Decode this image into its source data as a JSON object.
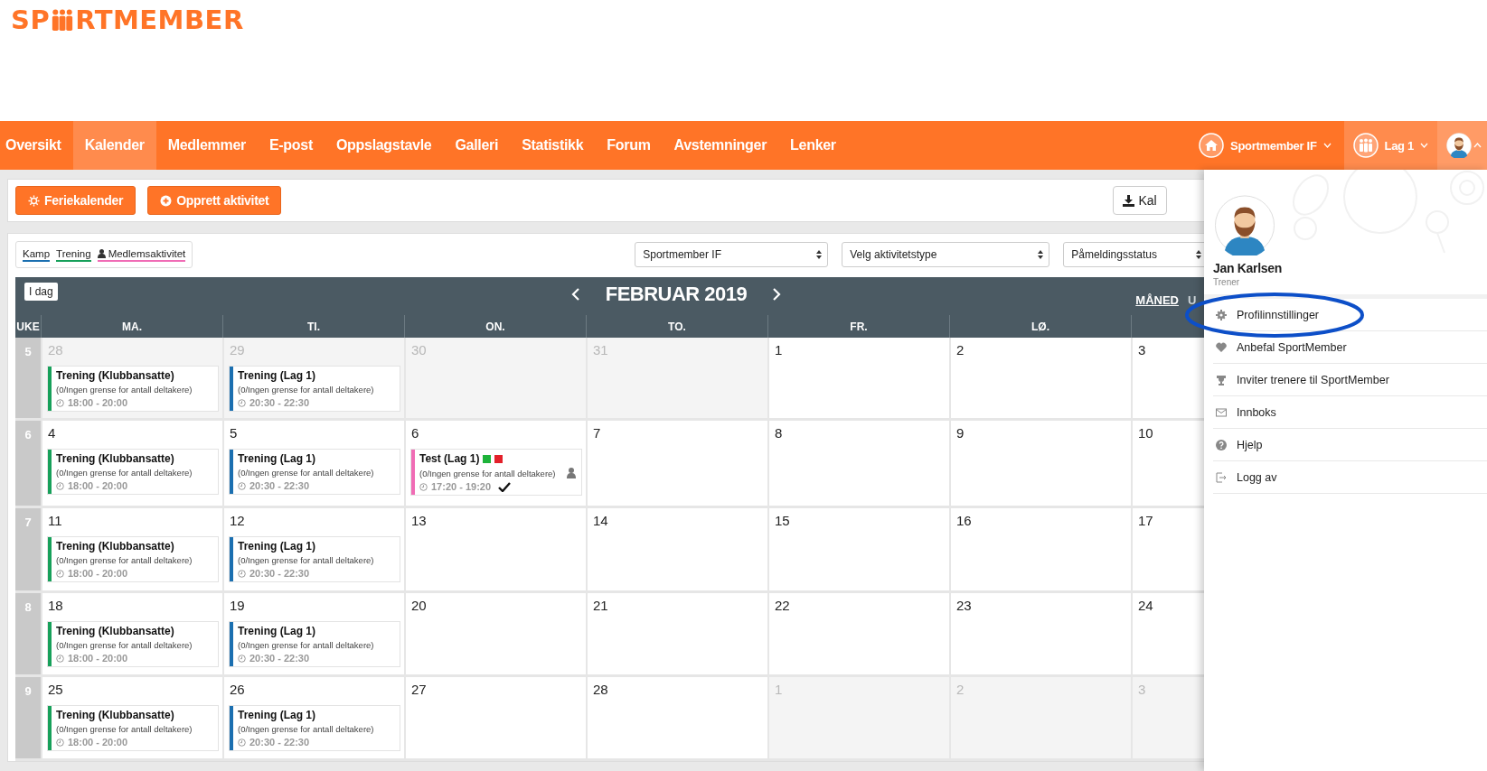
{
  "logo": {
    "text_before": "SP",
    "text_after": "RTMEMBER"
  },
  "nav": {
    "items": [
      {
        "label": "Oversikt",
        "selected": false
      },
      {
        "label": "Kalender",
        "selected": true
      },
      {
        "label": "Medlemmer",
        "selected": false
      },
      {
        "label": "E-post",
        "selected": false
      },
      {
        "label": "Oppslagstavle",
        "selected": false
      },
      {
        "label": "Galleri",
        "selected": false
      },
      {
        "label": "Statistikk",
        "selected": false
      },
      {
        "label": "Forum",
        "selected": false
      },
      {
        "label": "Avstemninger",
        "selected": false
      },
      {
        "label": "Lenker",
        "selected": false
      }
    ],
    "club": "Sportmember IF",
    "team": "Lag 1"
  },
  "toolbar": {
    "buttons": [
      "Feriekalender",
      "Opprett aktivitet"
    ],
    "export_button": "Kal"
  },
  "filters": {
    "legend": [
      {
        "label": "Kamp",
        "color": "#1b6fb0",
        "kind": "plain"
      },
      {
        "label": "Trening",
        "color": "#17a05a",
        "kind": "plain"
      },
      {
        "label": "Medlemsaktivitet",
        "color": "#f06cb5",
        "kind": "member"
      }
    ],
    "selects": [
      "Sportmember IF",
      "Velg aktivitetstype",
      "Påmeldingsstatus"
    ]
  },
  "calendar": {
    "today_button": "I dag",
    "title": "FEBRUAR 2019",
    "views": [
      {
        "label": "MÅNED",
        "selected": true
      },
      {
        "label": "U",
        "selected": false
      }
    ],
    "week_label": "UKE",
    "day_headers": [
      "MA.",
      "TI.",
      "ON.",
      "TO.",
      "FR.",
      "LØ."
    ],
    "weeks": [
      {
        "number": "5",
        "days": [
          {
            "date": "28",
            "in_month": false,
            "events": [
              {
                "title": "Trening (Klubbansatte)",
                "participants": "(0/Ingen grense for antall deltakere)",
                "time": "18:00 - 20:00",
                "color": "#17a05a",
                "kind": "training",
                "responded": false
              }
            ]
          },
          {
            "date": "29",
            "in_month": false,
            "events": [
              {
                "title": "Trening (Lag 1)",
                "participants": "(0/Ingen grense for antall deltakere)",
                "time": "20:30 - 22:30",
                "color": "#1b6fb0",
                "kind": "training",
                "responded": false
              }
            ]
          },
          {
            "date": "30",
            "in_month": false
          },
          {
            "date": "31",
            "in_month": false
          },
          {
            "date": "1",
            "in_month": true
          },
          {
            "date": "2",
            "in_month": true
          },
          {
            "date": "3",
            "in_month": true
          }
        ]
      },
      {
        "number": "6",
        "days": [
          {
            "date": "4",
            "in_month": true,
            "events": [
              {
                "title": "Trening (Klubbansatte)",
                "participants": "(0/Ingen grense for antall deltakere)",
                "time": "18:00 - 20:00",
                "color": "#17a05a",
                "kind": "training",
                "responded": false
              }
            ]
          },
          {
            "date": "5",
            "in_month": true,
            "events": [
              {
                "title": "Trening (Lag 1)",
                "participants": "(0/Ingen grense for antall deltakere)",
                "time": "20:30 - 22:30",
                "color": "#1b6fb0",
                "kind": "training",
                "responded": false
              }
            ]
          },
          {
            "date": "6",
            "in_month": true,
            "events": [
              {
                "title": "Test (Lag 1)",
                "participants": "(0/Ingen grense for antall deltakere)",
                "time": "17:20 - 19:20",
                "color": "#f06cb5",
                "kind": "member",
                "status_marks": [
                  {
                    "color": "#1db33a"
                  },
                  {
                    "color": "#e3202a"
                  }
                ],
                "responded": true
              }
            ]
          },
          {
            "date": "7",
            "in_month": true
          },
          {
            "date": "8",
            "in_month": true
          },
          {
            "date": "9",
            "in_month": true
          },
          {
            "date": "10",
            "in_month": true
          }
        ]
      },
      {
        "number": "7",
        "days": [
          {
            "date": "11",
            "in_month": true,
            "events": [
              {
                "title": "Trening (Klubbansatte)",
                "participants": "(0/Ingen grense for antall deltakere)",
                "time": "18:00 - 20:00",
                "color": "#17a05a",
                "kind": "training",
                "responded": false
              }
            ]
          },
          {
            "date": "12",
            "in_month": true,
            "events": [
              {
                "title": "Trening (Lag 1)",
                "participants": "(0/Ingen grense for antall deltakere)",
                "time": "20:30 - 22:30",
                "color": "#1b6fb0",
                "kind": "training",
                "responded": false
              }
            ]
          },
          {
            "date": "13",
            "in_month": true
          },
          {
            "date": "14",
            "in_month": true
          },
          {
            "date": "15",
            "in_month": true
          },
          {
            "date": "16",
            "in_month": true
          },
          {
            "date": "17",
            "in_month": true
          }
        ]
      },
      {
        "number": "8",
        "days": [
          {
            "date": "18",
            "in_month": true,
            "events": [
              {
                "title": "Trening (Klubbansatte)",
                "participants": "(0/Ingen grense for antall deltakere)",
                "time": "18:00 - 20:00",
                "color": "#17a05a",
                "kind": "training",
                "responded": false
              }
            ]
          },
          {
            "date": "19",
            "in_month": true,
            "events": [
              {
                "title": "Trening (Lag 1)",
                "participants": "(0/Ingen grense for antall deltakere)",
                "time": "20:30 - 22:30",
                "color": "#1b6fb0",
                "kind": "training",
                "responded": false
              }
            ]
          },
          {
            "date": "20",
            "in_month": true
          },
          {
            "date": "21",
            "in_month": true
          },
          {
            "date": "22",
            "in_month": true
          },
          {
            "date": "23",
            "in_month": true
          },
          {
            "date": "24",
            "in_month": true
          }
        ]
      },
      {
        "number": "9",
        "days": [
          {
            "date": "25",
            "in_month": true,
            "events": [
              {
                "title": "Trening (Klubbansatte)",
                "participants": "(0/Ingen grense for antall deltakere)",
                "time": "18:00 - 20:00",
                "color": "#17a05a",
                "kind": "training",
                "responded": false
              }
            ]
          },
          {
            "date": "26",
            "in_month": true,
            "events": [
              {
                "title": "Trening (Lag 1)",
                "participants": "(0/Ingen grense for antall deltakere)",
                "time": "20:30 - 22:30",
                "color": "#1b6fb0",
                "kind": "training",
                "responded": false
              }
            ]
          },
          {
            "date": "27",
            "in_month": true
          },
          {
            "date": "28",
            "in_month": true
          },
          {
            "date": "1",
            "in_month": false
          },
          {
            "date": "2",
            "in_month": false
          },
          {
            "date": "3",
            "in_month": false
          }
        ]
      }
    ]
  },
  "profile": {
    "name": "Jan Karlsen",
    "role": "Trener",
    "menu": [
      {
        "label": "Profilinnstillinger",
        "circled": true
      },
      {
        "label": "Anbefal SportMember",
        "circled": false
      },
      {
        "label": "Inviter trenere til SportMember",
        "circled": false
      },
      {
        "label": "Innboks",
        "circled": false
      },
      {
        "label": "Hjelp",
        "circled": false
      },
      {
        "label": "Logg av",
        "circled": false
      }
    ]
  }
}
